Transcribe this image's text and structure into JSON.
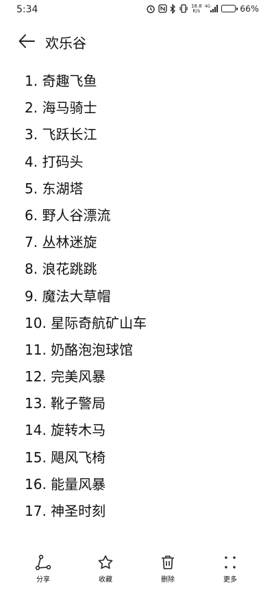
{
  "status_bar": {
    "time": "5:34",
    "net_speed_value": "18.8",
    "net_speed_unit": "K/s",
    "signal_label": "4G",
    "battery_percent": "66%",
    "battery_level": 0.66,
    "icons": [
      "alarm-icon",
      "nfc-icon",
      "bluetooth-icon",
      "vibrate-icon",
      "signal-icon",
      "battery-icon"
    ]
  },
  "header": {
    "title": "欢乐谷"
  },
  "list": {
    "items": [
      "1.  奇趣飞鱼",
      "2.  海马骑士",
      "3.  飞跃长江",
      "4.  打码头",
      "5.  东湖塔",
      "6.  野人谷漂流",
      "7.  丛林迷旋",
      "8.  浪花跳跳",
      "9.  魔法大草帽",
      "10. 星际奇航矿山车",
      "11. 奶酪泡泡球馆",
      "12. 完美风暴",
      "13. 靴子警局",
      "14. 旋转木马",
      "15. 飓风飞椅",
      "16. 能量风暴",
      "17. 神圣时刻"
    ]
  },
  "toolbar": {
    "share_label": "分享",
    "favorite_label": "收藏",
    "delete_label": "删除",
    "more_label": "更多"
  }
}
